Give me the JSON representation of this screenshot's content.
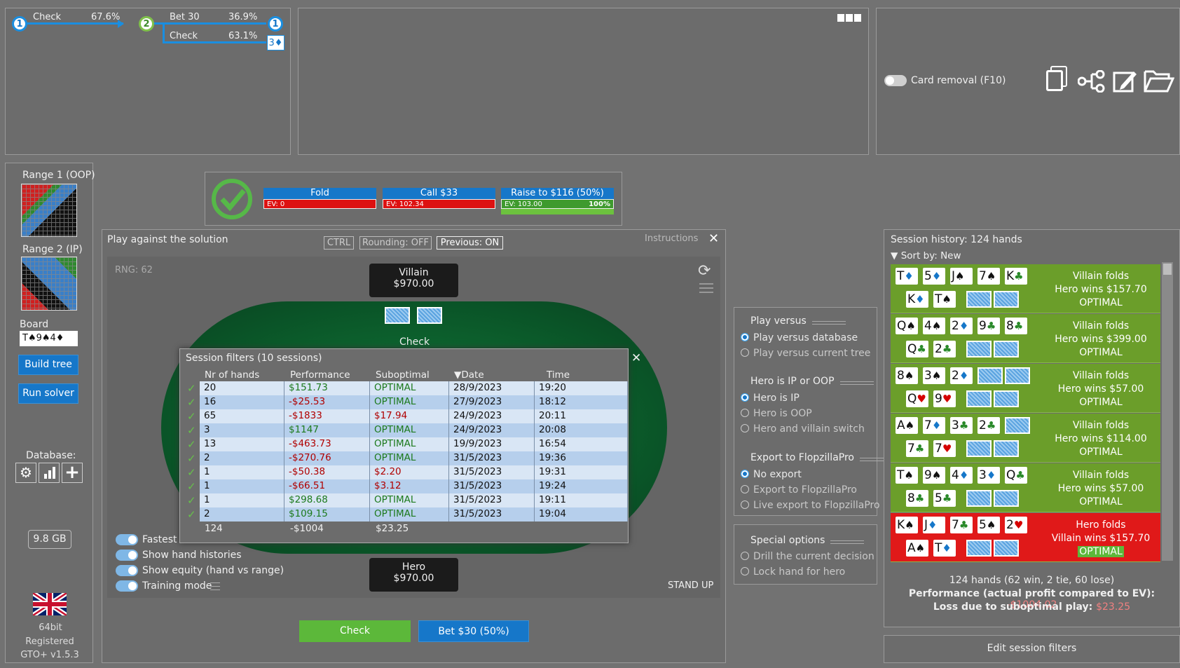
{
  "tree": {
    "n1": "1",
    "check": "Check",
    "check_pct": "67.6%",
    "n2": "2",
    "bet": "Bet 30",
    "bet_pct": "36.9%",
    "n3": "1",
    "check2": "Check",
    "check2_pct": "63.1%",
    "card": "3♦"
  },
  "card_removal": "Card removal (F10)",
  "left": {
    "range1": "Range 1 (OOP)",
    "range2": "Range 2 (IP)",
    "board_label": "Board",
    "board_value": "T♠9♠4♦",
    "build": "Build tree",
    "run": "Run solver",
    "database": "Database:",
    "memory": "9.8 GB",
    "bits": "64bit",
    "registered": "Registered",
    "version": "GTO+ v1.5.3"
  },
  "actions": [
    {
      "label": "Fold",
      "ev": "EV: 0",
      "pct": ""
    },
    {
      "label": "Call $33",
      "ev": "EV: 102.34",
      "pct": ""
    },
    {
      "label": "Raise to $116 (50%)",
      "ev": "EV: 103.00",
      "pct": "100%"
    }
  ],
  "play": {
    "title": "Play against the solution",
    "ctrl": "CTRL",
    "rounding": "Rounding: OFF",
    "previous": "Previous: ON",
    "instructions": "Instructions",
    "rng": "RNG: 62",
    "villain": "Villain",
    "villain_stack": "$970.00",
    "villain_action": "Check",
    "hero": "Hero",
    "hero_stack": "$970.00",
    "stand_up": "STAND UP",
    "fastest": "Fastest",
    "hh": "Show hand histories",
    "equity": "Show equity (hand vs range)",
    "training": "Training mode",
    "btn_check": "Check",
    "btn_bet": "Bet $30 (50%)"
  },
  "filters": {
    "title": "Session filters (10 sessions)",
    "headers": [
      "Nr of hands",
      "Performance",
      "Suboptimal",
      "Date",
      "Time"
    ],
    "rows": [
      [
        "20",
        "$151.73",
        "OPTIMAL",
        "28/9/2023",
        "19:20"
      ],
      [
        "16",
        "-$25.53",
        "OPTIMAL",
        "27/9/2023",
        "18:12"
      ],
      [
        "65",
        "-$1833",
        "$17.94",
        "24/9/2023",
        "20:11"
      ],
      [
        "3",
        "$1147",
        "OPTIMAL",
        "24/9/2023",
        "20:08"
      ],
      [
        "13",
        "-$463.73",
        "OPTIMAL",
        "19/9/2023",
        "16:54"
      ],
      [
        "2",
        "-$270.76",
        "OPTIMAL",
        "31/5/2023",
        "19:36"
      ],
      [
        "1",
        "-$50.38",
        "$2.20",
        "31/5/2023",
        "19:31"
      ],
      [
        "1",
        "-$66.51",
        "$3.12",
        "31/5/2023",
        "19:24"
      ],
      [
        "1",
        "$298.68",
        "OPTIMAL",
        "31/5/2023",
        "19:11"
      ],
      [
        "2",
        "$109.15",
        "OPTIMAL",
        "31/5/2023",
        "19:04"
      ]
    ],
    "total": [
      "124",
      "-$1004",
      "$23.25"
    ]
  },
  "options": {
    "play_versus": "Play versus",
    "pv_db": "Play versus database",
    "pv_tree": "Play versus current tree",
    "hero_pos": "Hero is IP or OOP",
    "hero_ip": "Hero is IP",
    "hero_oop": "Hero is OOP",
    "switch": "Hero and villain switch",
    "export": "Export to FlopzillaPro",
    "no_export": "No export",
    "export_fz": "Export to FlopzillaPro",
    "live_export": "Live export to FlopzillaPro",
    "special": "Special options",
    "drill": "Drill the current decision",
    "lock": "Lock hand for hero"
  },
  "history": {
    "title": "Session history: 124 hands",
    "sort": "Sort by: New",
    "hands": [
      {
        "r1": "Villain folds",
        "r2": "Hero wins $157.70",
        "r3": "OPTIMAL"
      },
      {
        "r1": "Villain folds",
        "r2": "Hero wins $399.00",
        "r3": "OPTIMAL"
      },
      {
        "r1": "Villain folds",
        "r2": "Hero wins $57.00",
        "r3": "OPTIMAL"
      },
      {
        "r1": "Villain folds",
        "r2": "Hero wins $114.00",
        "r3": "OPTIMAL"
      },
      {
        "r1": "Villain folds",
        "r2": "Hero wins $57.00",
        "r3": "OPTIMAL"
      },
      {
        "r1": "Hero folds",
        "r2": "Villain wins $157.70",
        "r3": "OPTIMAL"
      }
    ],
    "summary": "124 hands (62 win, 2 tie, 60 lose)",
    "perf_label": "Performance (actual profit compared to EV):",
    "perf_value": "-$1004.02",
    "loss_label": "Loss due to suboptimal play:",
    "loss_value": "$23.25",
    "edit": "Edit session filters"
  }
}
